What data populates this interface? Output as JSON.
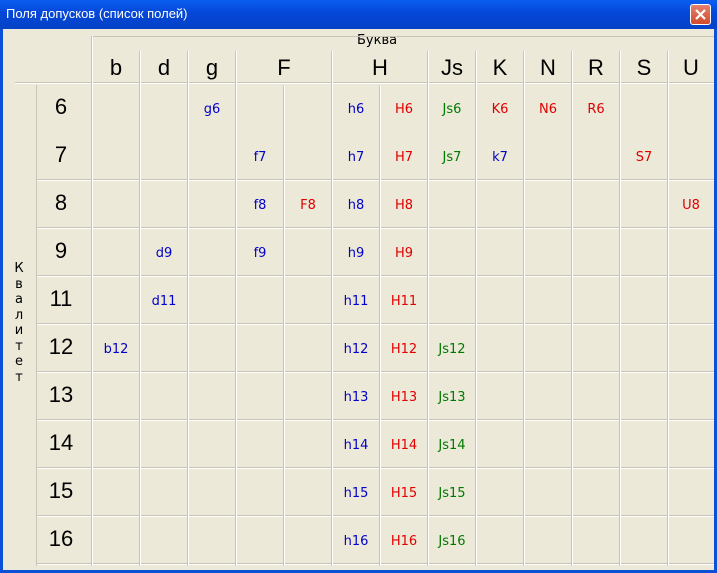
{
  "window": {
    "title": "Поля допусков (список полей)"
  },
  "header": {
    "letter_label": "Буква",
    "grade_label": "Квалитет"
  },
  "letters": [
    "b",
    "d",
    "g",
    "F",
    "H",
    "Js",
    "K",
    "N",
    "R",
    "S",
    "U"
  ],
  "grades": [
    "6",
    "7",
    "8",
    "9",
    "11",
    "12",
    "13",
    "14",
    "15",
    "16"
  ],
  "cells": {
    "6": [
      "g6",
      "h6",
      "H6",
      "Js6",
      "K6",
      "N6",
      "R6"
    ],
    "7": [
      "f7",
      "h7",
      "H7",
      "Js7",
      "k7",
      "S7"
    ],
    "8": [
      "f8",
      "F8",
      "h8",
      "H8",
      "U8"
    ],
    "9": [
      "d9",
      "f9",
      "h9",
      "H9"
    ],
    "11": [
      "d11",
      "h11",
      "H11"
    ],
    "12": [
      "b12",
      "h12",
      "H12",
      "Js12"
    ],
    "13": [
      "h13",
      "H13",
      "Js13"
    ],
    "14": [
      "h14",
      "H14",
      "Js14"
    ],
    "15": [
      "h15",
      "H15",
      "Js15"
    ],
    "16": [
      "h16",
      "H16",
      "Js16"
    ]
  },
  "colors": {
    "shaft": "#0000c8",
    "hole": "#e00000",
    "js": "#007a00"
  }
}
